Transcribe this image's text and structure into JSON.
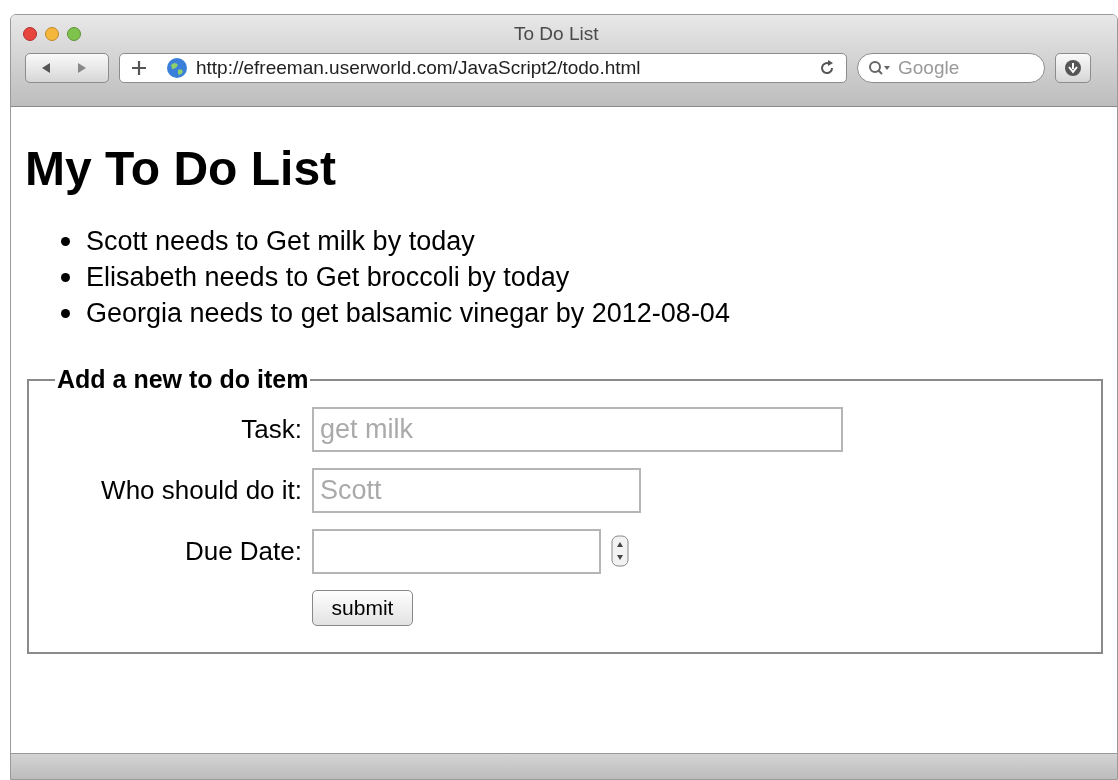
{
  "window": {
    "title": "To Do List"
  },
  "toolbar": {
    "url": "http://efreeman.userworld.com/JavaScript2/todo.html",
    "search": {
      "placeholder": "Google"
    }
  },
  "page": {
    "heading": "My To Do List",
    "items": [
      "Scott needs to Get milk by today",
      "Elisabeth needs to Get broccoli by today",
      "Georgia needs to get balsamic vinegar by 2012-08-04"
    ],
    "form": {
      "legend": "Add a new to do item",
      "fields": [
        {
          "kind": "text",
          "label": "Task:",
          "placeholder": "get milk"
        },
        {
          "kind": "text",
          "label": "Who should do it:",
          "placeholder": "Scott"
        },
        {
          "kind": "date",
          "label": "Due Date:"
        }
      ],
      "submit": "submit"
    }
  }
}
